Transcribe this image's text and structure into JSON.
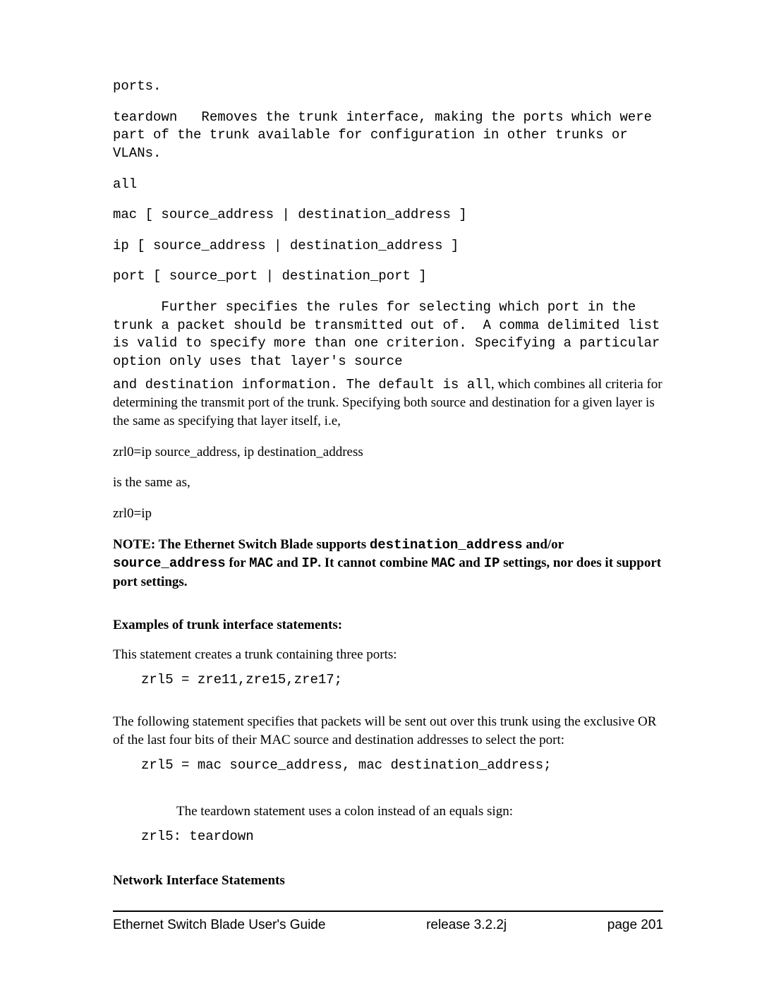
{
  "body": {
    "ports_line": "ports.",
    "teardown_desc": "teardown   Removes the trunk interface, making the ports which were part of the trunk available for configuration in other trunks or VLANs.",
    "all_line": "all",
    "mac_line": "mac [ source_address | destination_address ]",
    "ip_line": "ip [ source_address | destination_address ]",
    "port_line": "port [ source_port | destination_port ]",
    "further_para": "      Further specifies the rules for selecting which port in the trunk a packet should be transmitted out of.  A comma delimited list is valid to specify more than one criterion. Specifying a particular option only uses that layer's source",
    "mixed_lead_mono": "and destination information. The default is ",
    "mixed_all_word": "all",
    "mixed_tail_serif": ", which combines all criteria for determining the transmit port of the trunk. Specifying both source and destination for a given layer is the same as specifying that layer itself, i.e,",
    "zrl0_long": "zrl0=ip source_address, ip destination_address",
    "is_same_as": "is the same as,",
    "zrl0_short": "zrl0=ip",
    "note_prefix": "NOTE: The Ethernet Switch Blade supports ",
    "note_dest": "destination_address",
    "note_andor": " and/or ",
    "note_src": "source_address",
    "note_for": " for ",
    "note_mac": "MAC",
    "note_and": " and ",
    "note_ip": "IP",
    "note_mid": ". It cannot combine ",
    "note_mac2": "MAC",
    "note_and2": " and ",
    "note_ip2": "IP",
    "note_tail": " settings, nor does it support port settings.",
    "examples_heading": "Examples of trunk interface statements:",
    "stmt_three_ports": "This statement creates a trunk containing three ports:",
    "code_three_ports": "zrl5 = zre11,zre15,zre17;",
    "following_stmt": "The following statement specifies that packets will be sent out over this trunk using the exclusive OR of the last four bits of their MAC source and destination addresses to select the port:",
    "code_mac": "zrl5 = mac source_address, mac destination_address;",
    "teardown_note": "The teardown statement uses a colon instead of an equals sign:",
    "code_teardown": "zrl5: teardown",
    "net_heading": "Network Interface Statements"
  },
  "footer": {
    "left": "Ethernet Switch Blade User's Guide",
    "center": "release  3.2.2j",
    "right": "page  201"
  }
}
